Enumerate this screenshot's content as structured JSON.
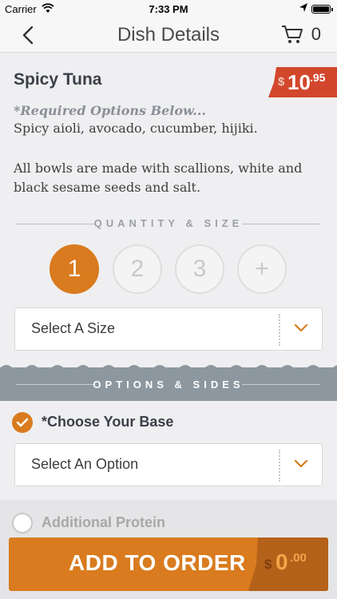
{
  "status_bar": {
    "carrier": "Carrier",
    "time": "7:33 PM"
  },
  "nav": {
    "title": "Dish Details",
    "cart_count": "0"
  },
  "dish": {
    "name": "Spicy Tuna",
    "price_currency": "$",
    "price_whole": "10",
    "price_cents": ".95",
    "required_note": "*Required Options Below...",
    "ingredients": "Spicy aioli, avocado, cucumber, hijiki.",
    "note": "All bowls are made with scallions, white and black sesame seeds and salt."
  },
  "quantity": {
    "section_label": "QUANTITY & SIZE",
    "options": [
      "1",
      "2",
      "3",
      "+"
    ],
    "selected": "1"
  },
  "size_select": {
    "value": "Select A Size"
  },
  "options_section": {
    "label": "OPTIONS & SIDES"
  },
  "base": {
    "label": "*Choose Your Base",
    "checked": true,
    "select_value": "Select An Option"
  },
  "protein": {
    "label": "Additional Protein",
    "checked": false
  },
  "add_button": {
    "label": "ADD TO ORDER",
    "currency": "$",
    "whole": "0",
    "cents": ".00"
  },
  "colors": {
    "accent": "#d97b1e",
    "price_tag": "#d2472c",
    "band": "#8c979f"
  },
  "icons": [
    "wifi-icon",
    "location-arrow-icon",
    "battery-icon",
    "back-chevron-icon",
    "cart-icon",
    "chevron-down-icon",
    "checkmark-icon"
  ]
}
